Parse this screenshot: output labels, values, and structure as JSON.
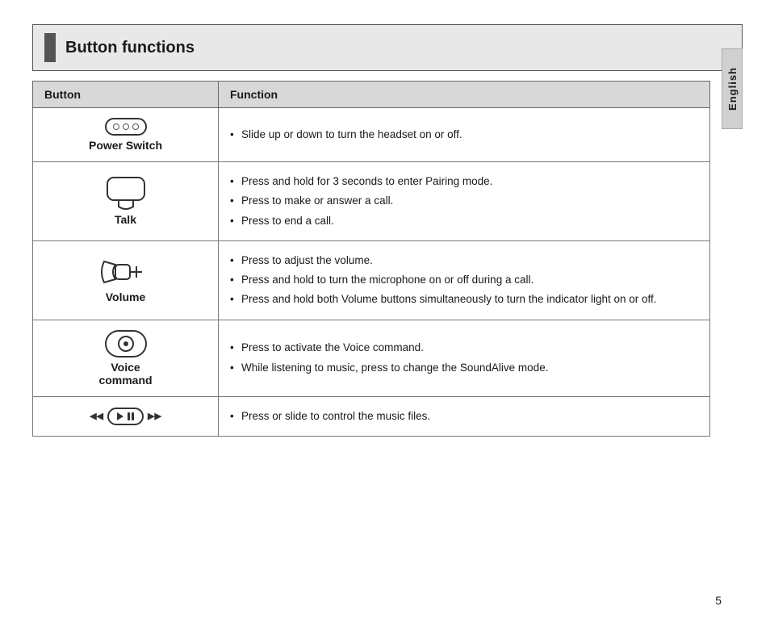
{
  "page": {
    "title": "Button functions",
    "english_tab": "English",
    "page_number": "5"
  },
  "table": {
    "col_button": "Button",
    "col_function": "Function"
  },
  "rows": [
    {
      "id": "power-switch",
      "button_label": "Power Switch",
      "functions": [
        "Slide up or down to turn the headset on or off."
      ]
    },
    {
      "id": "talk",
      "button_label": "Talk",
      "functions": [
        "Press and hold for 3 seconds to enter Pairing mode.",
        "Press to make or answer a call.",
        "Press to end a call."
      ]
    },
    {
      "id": "volume",
      "button_label": "Volume",
      "functions": [
        "Press to adjust the volume.",
        "Press and hold to turn the microphone on or off during a call.",
        "Press and hold both Volume buttons simultaneously to turn the indicator light on or off."
      ]
    },
    {
      "id": "voice-command",
      "button_label_line1": "Voice",
      "button_label_line2": "command",
      "functions": [
        "Press to activate the Voice command.",
        "While listening to music, press to change the SoundAlive mode."
      ]
    },
    {
      "id": "music",
      "button_label": "",
      "functions": [
        "Press or slide to control the music files."
      ]
    }
  ]
}
